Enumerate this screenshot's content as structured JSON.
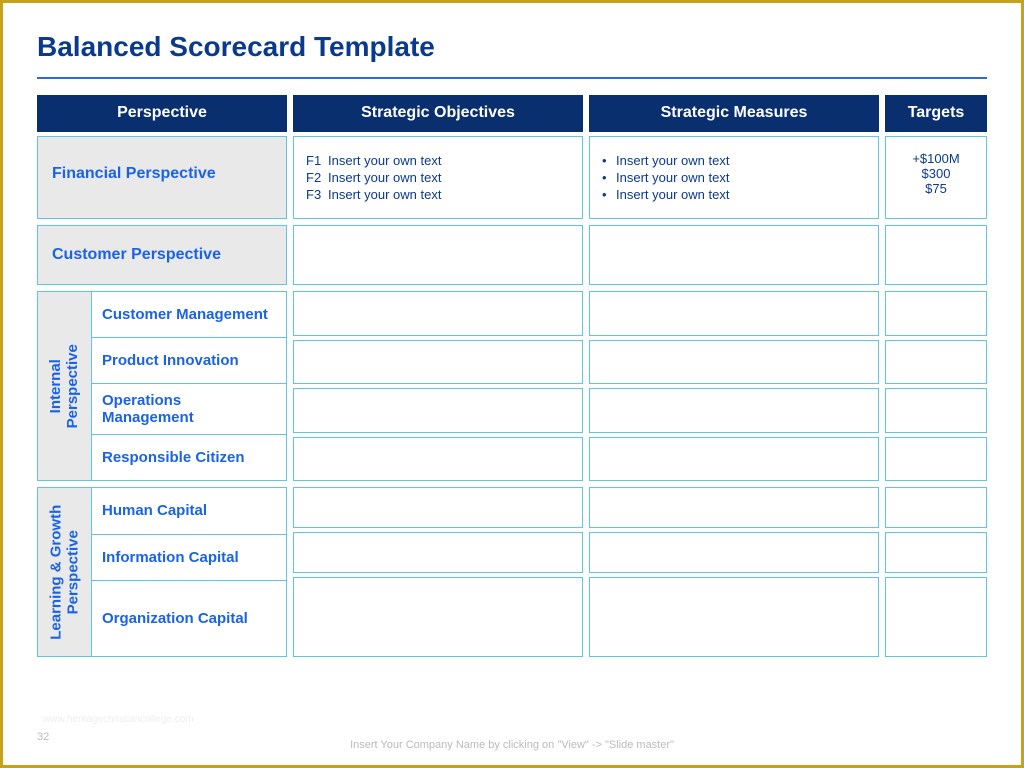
{
  "title": "Balanced Scorecard Template",
  "headers": [
    "Perspective",
    "Strategic Objectives",
    "Strategic Measures",
    "Targets"
  ],
  "rows": {
    "financial": {
      "label": "Financial Perspective",
      "objectives": [
        {
          "code": "F1",
          "text": "Insert your own text"
        },
        {
          "code": "F2",
          "text": "Insert your own text"
        },
        {
          "code": "F3",
          "text": "Insert your own text"
        }
      ],
      "measures": [
        "Insert your own text",
        "Insert your own text",
        "Insert your own text"
      ],
      "targets": [
        "+$100M",
        "$300",
        "$75"
      ]
    },
    "customer": {
      "label": "Customer Perspective"
    },
    "internal": {
      "label": "Internal Perspective",
      "subs": [
        "Customer Management",
        "Product Innovation",
        "Operations Management",
        "Responsible Citizen"
      ]
    },
    "learning": {
      "label": "Learning & Growth Perspective",
      "subs": [
        "Human Capital",
        "Information Capital",
        "Organization Capital"
      ]
    }
  },
  "footer": "Insert Your Company Name by clicking on \"View\" -> \"Slide master\"",
  "slide_number": "32",
  "watermark": "www.heritagechristiancollege.com"
}
